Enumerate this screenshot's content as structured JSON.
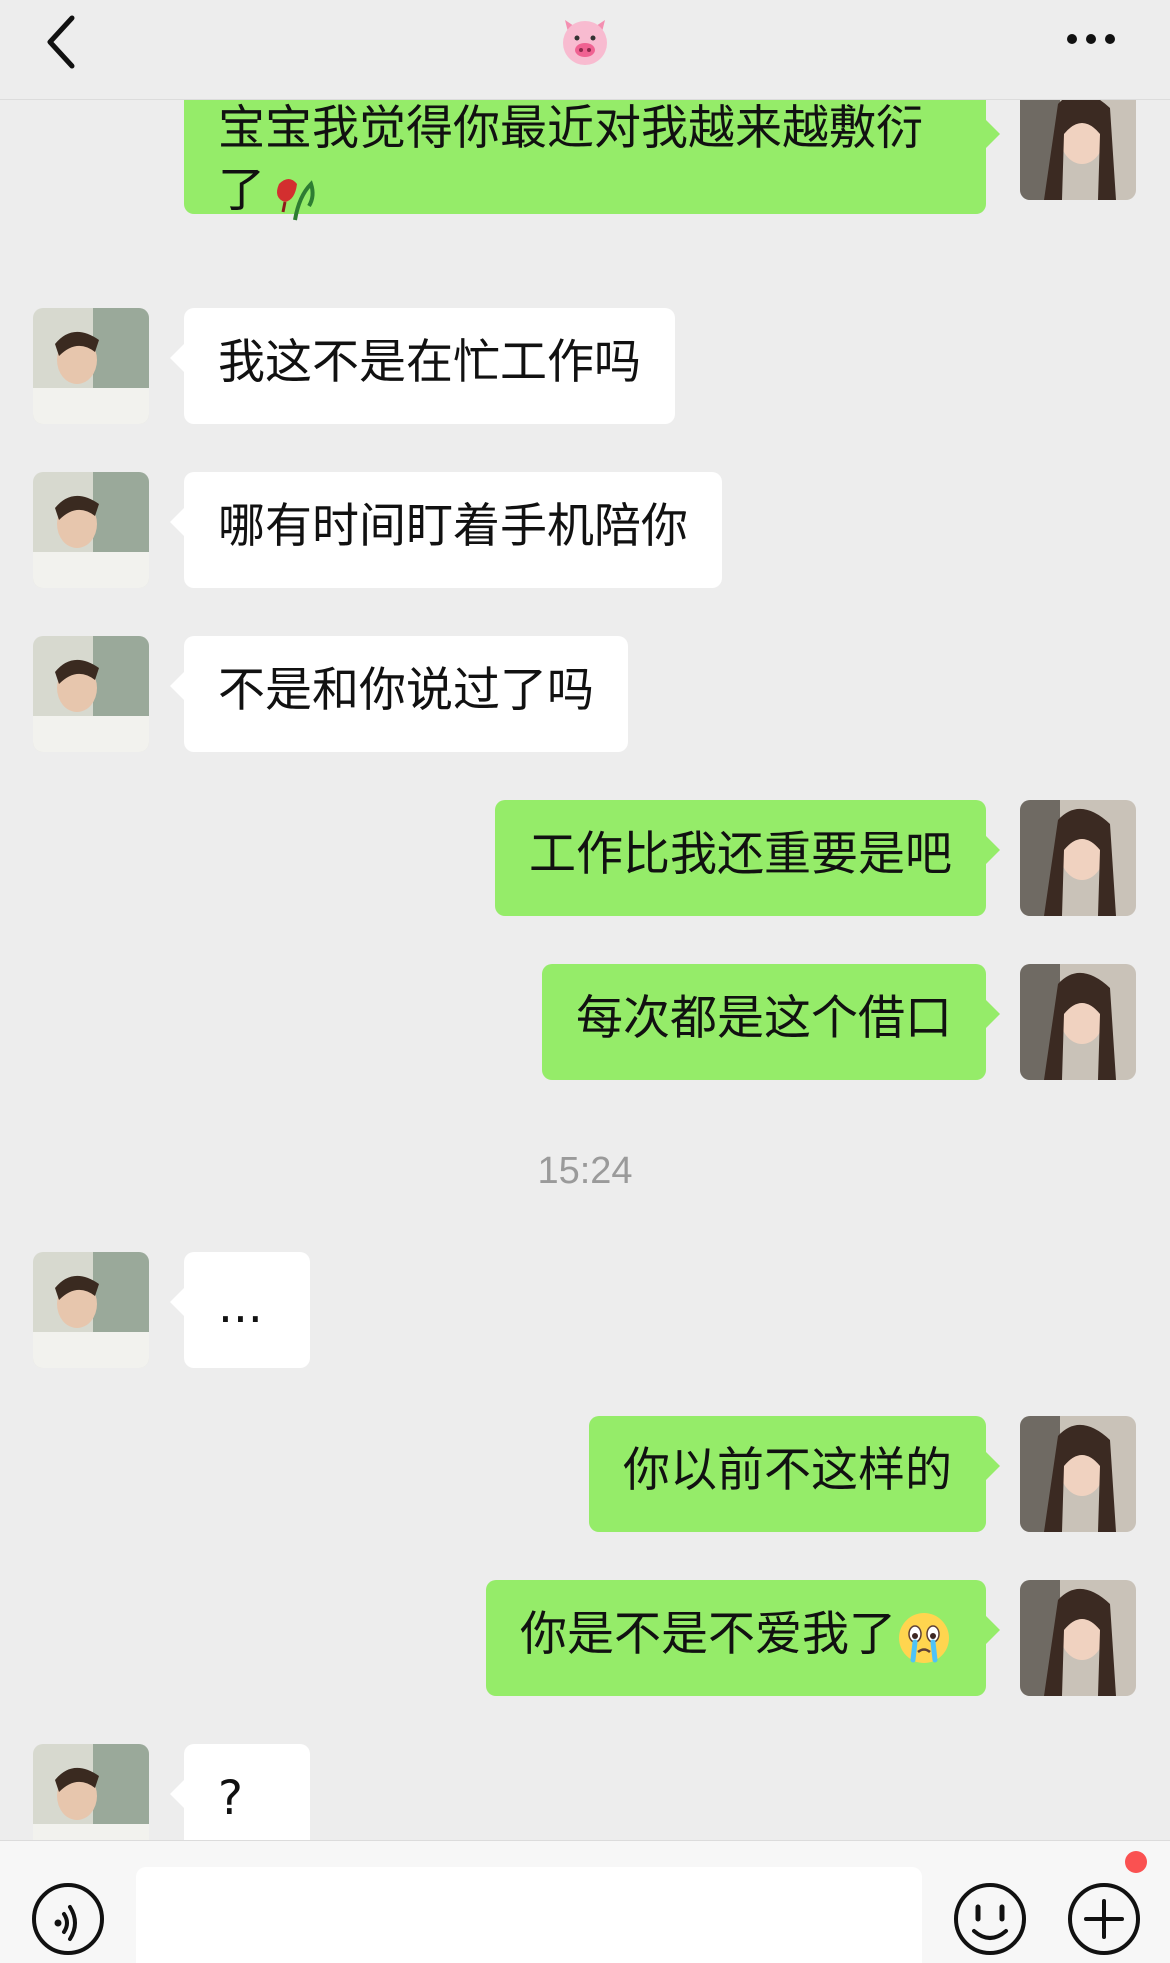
{
  "header": {
    "title_icon": "pig-face-emoji",
    "back_icon": "chevron-left-icon",
    "more_icon": "more-dots-icon"
  },
  "messages": [
    {
      "side": "out",
      "text": "宝宝我觉得你最近对我越来越敷衍",
      "text_line2": "了",
      "emoji": "wilted-flower"
    },
    {
      "side": "in",
      "text": "我这不是在忙工作吗"
    },
    {
      "side": "in",
      "text": "哪有时间盯着手机陪你"
    },
    {
      "side": "in",
      "text": "不是和你说过了吗"
    },
    {
      "side": "out",
      "text": "工作比我还重要是吧"
    },
    {
      "side": "out",
      "text": "每次都是这个借口"
    },
    {
      "side": "in",
      "text": "..."
    },
    {
      "side": "out",
      "text": "你以前不这样的"
    },
    {
      "side": "out",
      "text": "你是不是不爱我了",
      "emoji": "crying-face"
    },
    {
      "side": "in",
      "text": "?"
    }
  ],
  "timestamp": "15:24",
  "input_bar": {
    "voice_icon": "voice-icon",
    "input_value": "",
    "emoji_icon": "emoji-face-icon",
    "plus_icon": "plus-circle-icon",
    "has_badge": true
  },
  "colors": {
    "background": "#ededed",
    "outgoing_bubble": "#95ec69",
    "incoming_bubble": "#ffffff",
    "badge": "#fa5151"
  }
}
